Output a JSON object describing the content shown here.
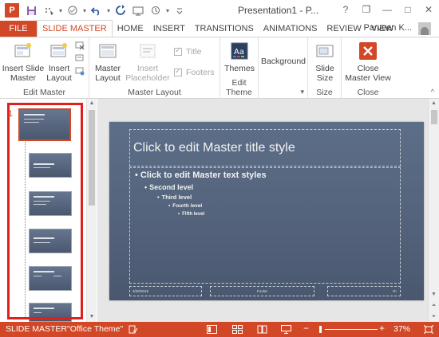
{
  "window": {
    "title": "Presentation1 - P...",
    "app_icon_letter": "P",
    "qat_dropdown": "▾",
    "controls": {
      "help": "?",
      "restore": "❐",
      "minimize": "—",
      "maximize": "□",
      "close": "✕"
    }
  },
  "tabs": [
    {
      "label": "FILE"
    },
    {
      "label": "SLIDE MASTER"
    },
    {
      "label": "HOME"
    },
    {
      "label": "INSERT"
    },
    {
      "label": "TRANSITIONS"
    },
    {
      "label": "ANIMATIONS"
    },
    {
      "label": "REVIEW"
    },
    {
      "label": "VIEW"
    }
  ],
  "user": {
    "name": "Parveen K..."
  },
  "ribbon": {
    "groups": {
      "edit_master": {
        "label": "Edit Master",
        "insert_slide_master": "Insert Slide\nMaster",
        "insert_layout": "Insert\nLayout"
      },
      "master_layout": {
        "label": "Master Layout",
        "master_layout": "Master\nLayout",
        "insert_placeholder": "Insert\nPlaceholder",
        "title_checkbox": "Title",
        "footers_checkbox": "Footers"
      },
      "edit_theme": {
        "label": "Edit Theme",
        "themes": "Themes"
      },
      "background": {
        "background": "Background"
      },
      "size": {
        "label": "Size",
        "slide_size": "Slide\nSize"
      },
      "close": {
        "label": "Close",
        "close_master_view": "Close\nMaster View"
      }
    }
  },
  "thumbnails": {
    "master_number": "1"
  },
  "slide": {
    "title_placeholder": "Click to edit Master title style",
    "levels": [
      "Click to edit Master text styles",
      "Second level",
      "Third level",
      "Fourth level",
      "Fifth level"
    ],
    "footer_date": "3/28/2015",
    "footer_text": "Footer",
    "footer_num": "‹#›"
  },
  "statusbar": {
    "mode": "SLIDE MASTER",
    "theme": "\"Office Theme\"",
    "zoom": "37%",
    "zoom_minus": "−",
    "zoom_plus": "+"
  },
  "colors": {
    "accent": "#d24726",
    "highlight": "#e0201d",
    "slide_bg": "#54647c"
  },
  "icons": [
    "save-icon",
    "undo-icon",
    "redo-icon",
    "start-from-beginning-icon",
    "themes-icon",
    "close-x-icon",
    "normal-view-icon",
    "slide-sorter-icon",
    "reading-view-icon",
    "slide-show-icon",
    "fit-slide-icon"
  ]
}
